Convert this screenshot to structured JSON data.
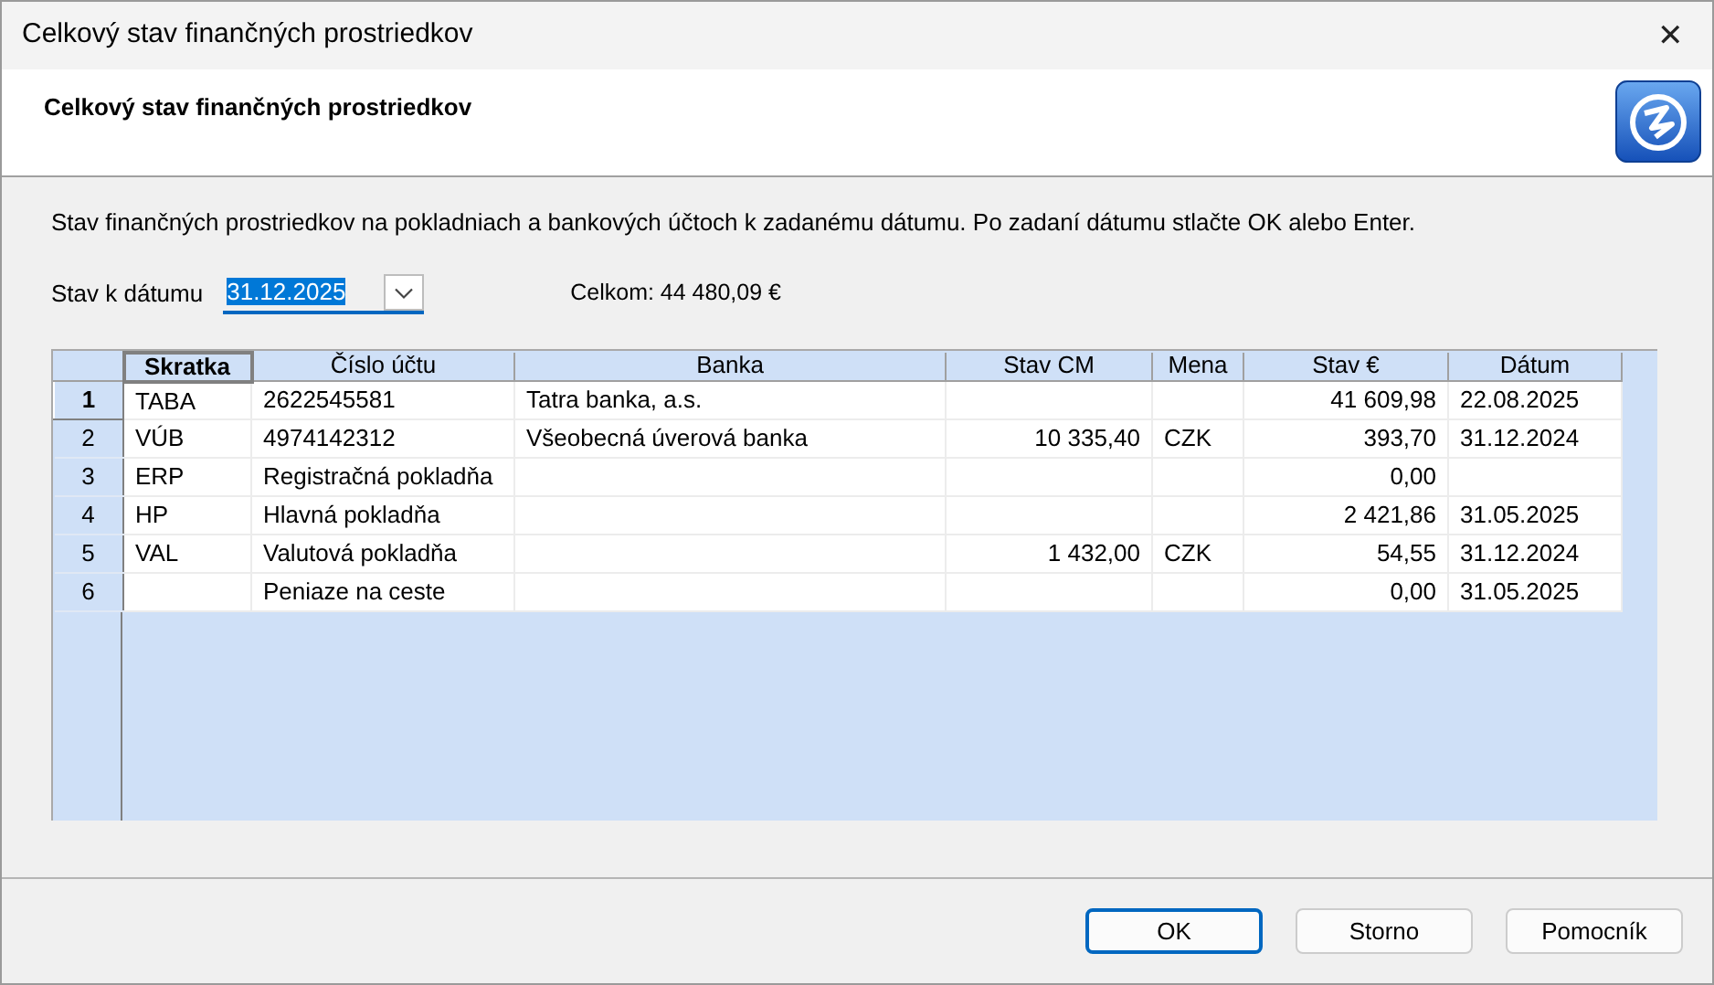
{
  "window": {
    "title": "Celkový stav finančných prostriedkov",
    "close": "✕"
  },
  "header": {
    "title": "Celkový stav finančných prostriedkov"
  },
  "description": "Stav finančných prostriedkov na pokladniach a bankových účtoch k zadanému dátumu. Po zadaní dátumu stlačte OK alebo Enter.",
  "date_field": {
    "label": "Stav k dátumu",
    "value": "31.12.2025"
  },
  "total": "Celkom: 44 480,09 €",
  "table": {
    "columns": [
      {
        "label": "Skratka",
        "kind": "text",
        "selected": true
      },
      {
        "label": "Číslo účtu",
        "kind": "text",
        "selected": false
      },
      {
        "label": "Banka",
        "kind": "text",
        "selected": false
      },
      {
        "label": "Stav CM",
        "kind": "amount",
        "selected": false
      },
      {
        "label": "Mena",
        "kind": "text",
        "selected": false
      },
      {
        "label": "Stav €",
        "kind": "amount",
        "selected": false
      },
      {
        "label": "Dátum",
        "kind": "text",
        "selected": false
      }
    ],
    "rows": [
      {
        "number": "1",
        "selected": true,
        "cells": [
          "TABA",
          "2622545581",
          "Tatra banka, a.s.",
          "",
          "",
          "41 609,98",
          "22.08.2025"
        ]
      },
      {
        "number": "2",
        "selected": false,
        "cells": [
          "VÚB",
          "4974142312",
          "Všeobecná úverová banka",
          "10 335,40",
          "CZK",
          "393,70",
          "31.12.2024"
        ]
      },
      {
        "number": "3",
        "selected": false,
        "cells": [
          "ERP",
          "Registračná pokladňa",
          "",
          "",
          "",
          "0,00",
          ""
        ]
      },
      {
        "number": "4",
        "selected": false,
        "cells": [
          "HP",
          "Hlavná pokladňa",
          "",
          "",
          "",
          "2 421,86",
          "31.05.2025"
        ]
      },
      {
        "number": "5",
        "selected": false,
        "cells": [
          "VAL",
          "Valutová pokladňa",
          "",
          "1 432,00",
          "CZK",
          "54,55",
          "31.12.2024"
        ]
      },
      {
        "number": "6",
        "selected": false,
        "cells": [
          "",
          "Peniaze na ceste",
          "",
          "",
          "",
          "0,00",
          "31.05.2025"
        ]
      }
    ]
  },
  "buttons": [
    {
      "label": "OK",
      "default": true
    },
    {
      "label": "Storno",
      "default": false
    },
    {
      "label": "Pomocník",
      "default": false
    }
  ]
}
